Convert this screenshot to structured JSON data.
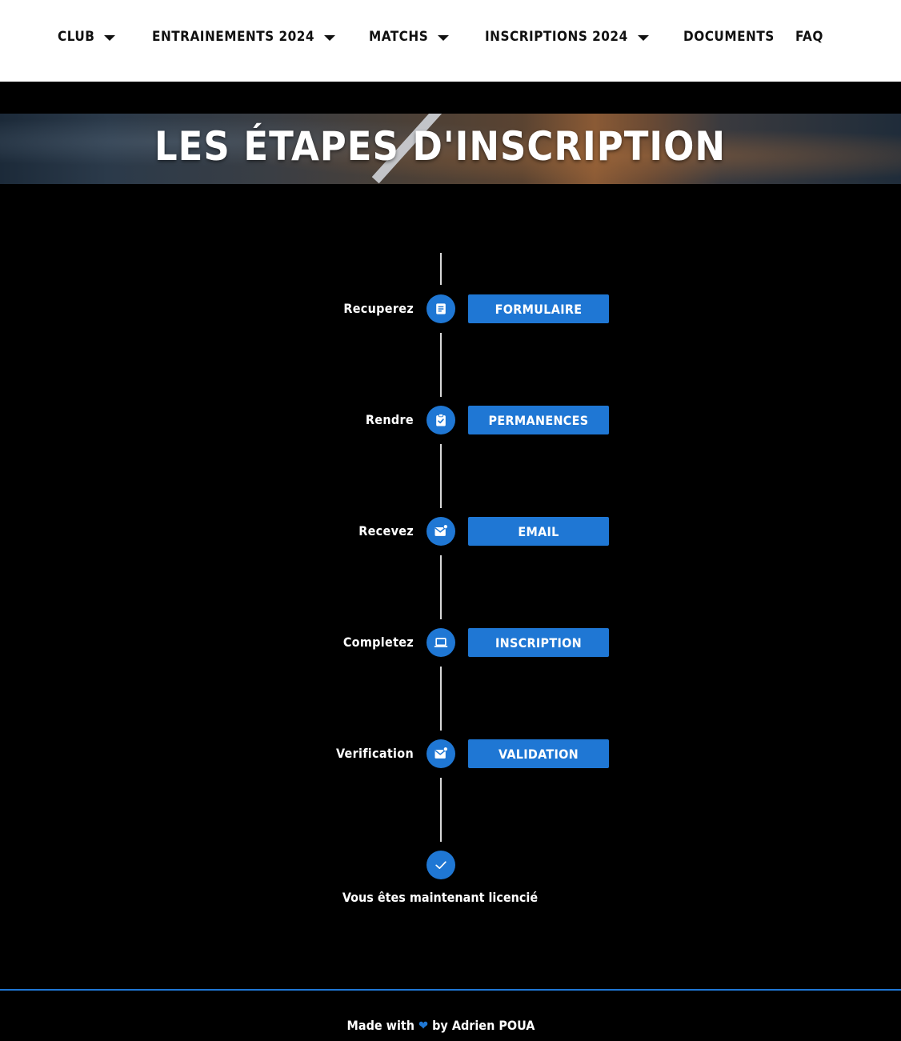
{
  "nav": {
    "club": "CLUB",
    "entrainements": "ENTRAINEMENTS 2024",
    "matchs": "MATCHS",
    "inscriptions": "INSCRIPTIONS 2024",
    "documents": "DOCUMENTS",
    "faq": "FAQ"
  },
  "hero": {
    "title": "LES ÉTAPES D'INSCRIPTION"
  },
  "steps": [
    {
      "label": "Recuperez",
      "icon": "document-icon",
      "button": "FORMULAIRE"
    },
    {
      "label": "Rendre",
      "icon": "clipboard-check-icon",
      "button": "PERMANENCES"
    },
    {
      "label": "Recevez",
      "icon": "mail-notification-icon",
      "button": "EMAIL"
    },
    {
      "label": "Completez",
      "icon": "laptop-icon",
      "button": "INSCRIPTION"
    },
    {
      "label": "Verification",
      "icon": "mail-notification-icon",
      "button": "VALIDATION"
    }
  ],
  "final": {
    "icon": "check-icon",
    "text": "Vous êtes maintenant licencié"
  },
  "footer": {
    "made_with": "Made with",
    "by": "by Adrien POUA"
  },
  "colors": {
    "accent": "#1f77d4",
    "background": "#000000",
    "nav_bg": "#ffffff"
  }
}
